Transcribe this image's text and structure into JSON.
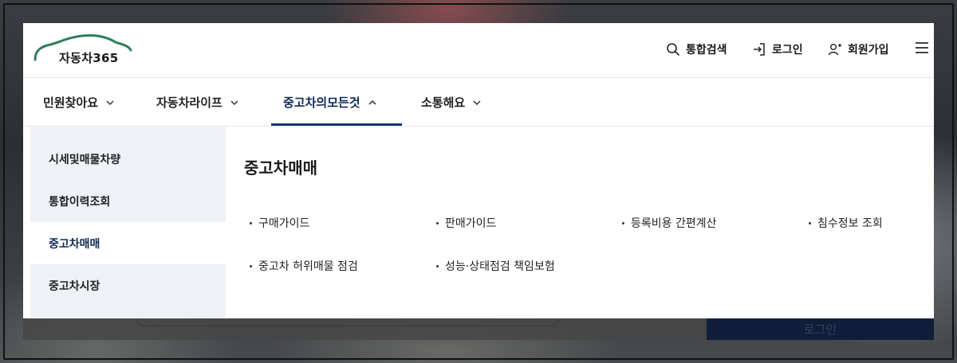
{
  "logo": {
    "text": "자동차365",
    "icon": "car-outline-logo"
  },
  "utility": {
    "search_label": "통합검색",
    "search_icon": "search-icon",
    "login_label": "로그인",
    "login_icon": "login-icon",
    "join_label": "회원가입",
    "join_icon": "user-add-icon",
    "menu_icon": "hamburger-menu-icon"
  },
  "nav": {
    "items": [
      {
        "label": "민원찾아요",
        "expanded": false
      },
      {
        "label": "자동차라이프",
        "expanded": false
      },
      {
        "label": "중고차의모든것",
        "expanded": true
      },
      {
        "label": "소통해요",
        "expanded": false
      }
    ]
  },
  "side": {
    "items": [
      {
        "label": "시세및매물차량",
        "active": false
      },
      {
        "label": "통합이력조회",
        "active": false
      },
      {
        "label": "중고차매매",
        "active": true
      },
      {
        "label": "중고차시장",
        "active": false
      }
    ]
  },
  "content": {
    "title": "중고차매매",
    "links": [
      "구매가이드",
      "판매가이드",
      "등록비용 간편계산",
      "침수정보 조회",
      "중고차 허위매물 점검",
      "성능·상태점검 책임보험"
    ]
  },
  "background": {
    "login_button": "로그인"
  },
  "colors": {
    "accent": "#0e3a70",
    "active_text": "#0e2a56",
    "logo_green": "#2e7d5b",
    "side_bg": "#eef1f5"
  }
}
